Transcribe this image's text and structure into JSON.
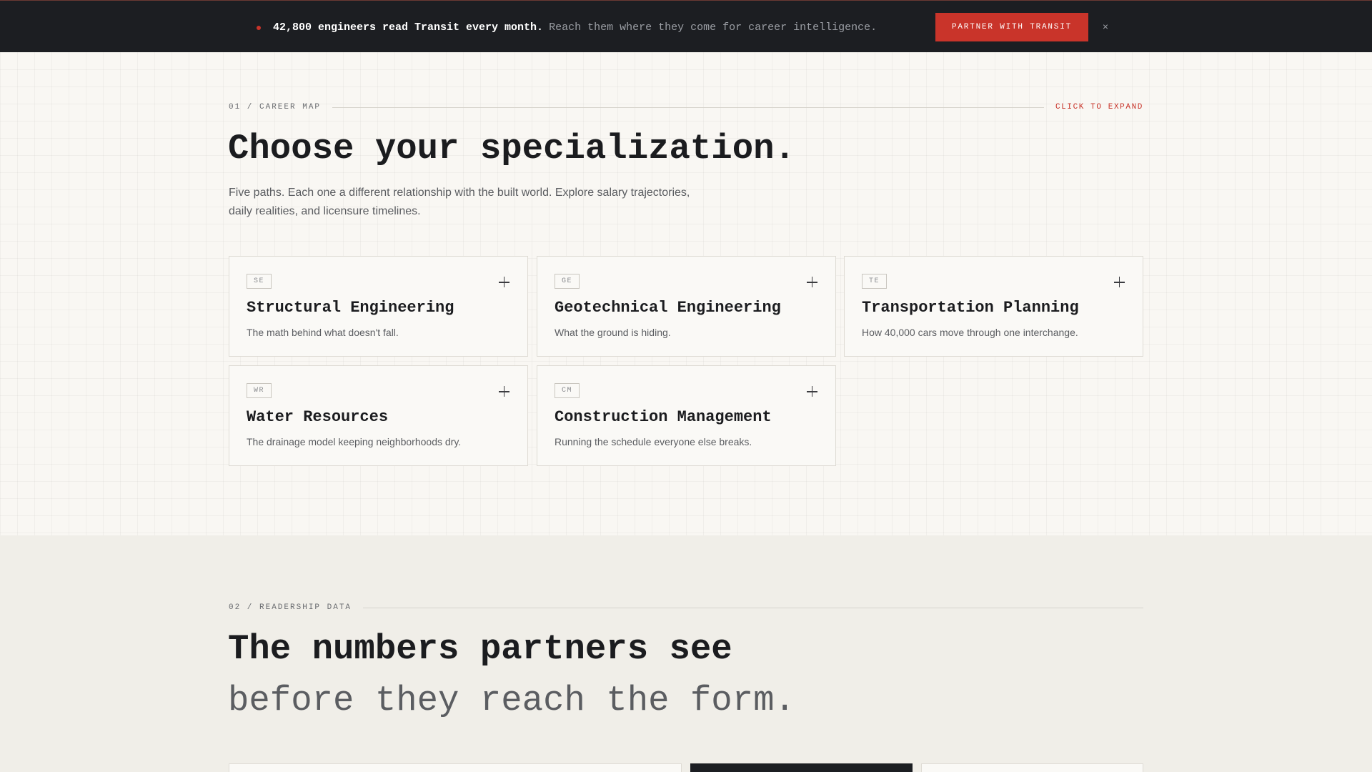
{
  "banner": {
    "headline": "42,800 engineers read Transit every month.",
    "subtext": "Reach them where they come for career intelligence.",
    "cta_label": "PARTNER WITH TRANSIT",
    "close_label": "×"
  },
  "career_map": {
    "eyebrow": "01 / CAREER MAP",
    "action_label": "CLICK TO EXPAND",
    "title": "Choose your specialization.",
    "lede": "Five paths. Each one a different relationship with the built world. Explore salary trajectories, daily realities, and licensure timelines.",
    "cards": [
      {
        "code": "SE",
        "title": "Structural Engineering",
        "desc": "The math behind what doesn't fall."
      },
      {
        "code": "GE",
        "title": "Geotechnical Engineering",
        "desc": "What the ground is hiding."
      },
      {
        "code": "TE",
        "title": "Transportation Planning",
        "desc": "How 40,000 cars move through one interchange."
      },
      {
        "code": "WR",
        "title": "Water Resources",
        "desc": "The drainage model keeping neighborhoods dry."
      },
      {
        "code": "CM",
        "title": "Construction Management",
        "desc": "Running the schedule everyone else breaks."
      }
    ]
  },
  "readership": {
    "eyebrow": "02 / READERSHIP DATA",
    "title": "The numbers partners see",
    "subtitle": "before they reach the form."
  },
  "colors": {
    "accent": "#c9342a",
    "banner_bg": "#1c1e22",
    "page_bg": "#f9f7f3",
    "section2_bg": "#f0eee8"
  }
}
